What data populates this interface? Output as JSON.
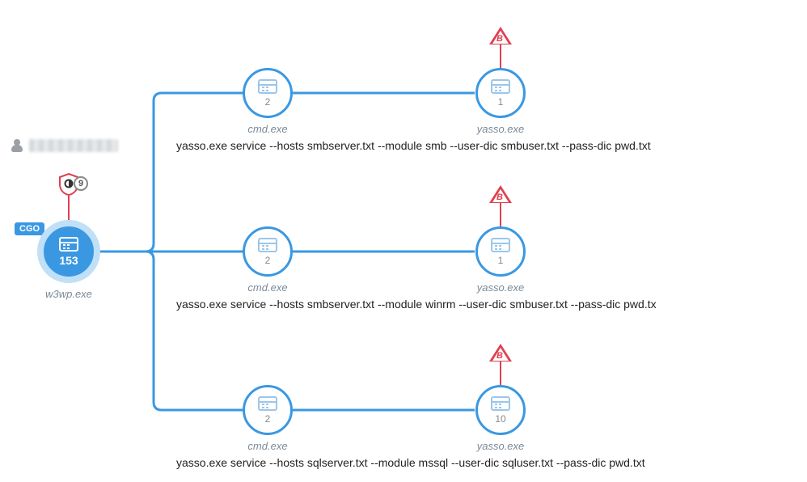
{
  "colors": {
    "accent": "#3a98e3",
    "alert": "#e04050"
  },
  "user": {
    "redacted": true
  },
  "root": {
    "label": "w3wp.exe",
    "count": "153",
    "tag": "CGO",
    "shield_badge": "9"
  },
  "rows": [
    {
      "cmd": {
        "label": "cmd.exe",
        "count": "2"
      },
      "yasso": {
        "label": "yasso.exe",
        "count": "1",
        "alert": "B"
      },
      "cmdline": "yasso.exe service --hosts smbserver.txt --module smb --user-dic smbuser.txt --pass-dic pwd.txt"
    },
    {
      "cmd": {
        "label": "cmd.exe",
        "count": "2"
      },
      "yasso": {
        "label": "yasso.exe",
        "count": "1",
        "alert": "B"
      },
      "cmdline": "yasso.exe service --hosts smbserver.txt --module winrm --user-dic smbuser.txt --pass-dic pwd.tx"
    },
    {
      "cmd": {
        "label": "cmd.exe",
        "count": "2"
      },
      "yasso": {
        "label": "yasso.exe",
        "count": "10",
        "alert": "B"
      },
      "cmdline": "yasso.exe service --hosts sqlserver.txt --module mssql --user-dic sqluser.txt --pass-dic pwd.txt"
    }
  ]
}
